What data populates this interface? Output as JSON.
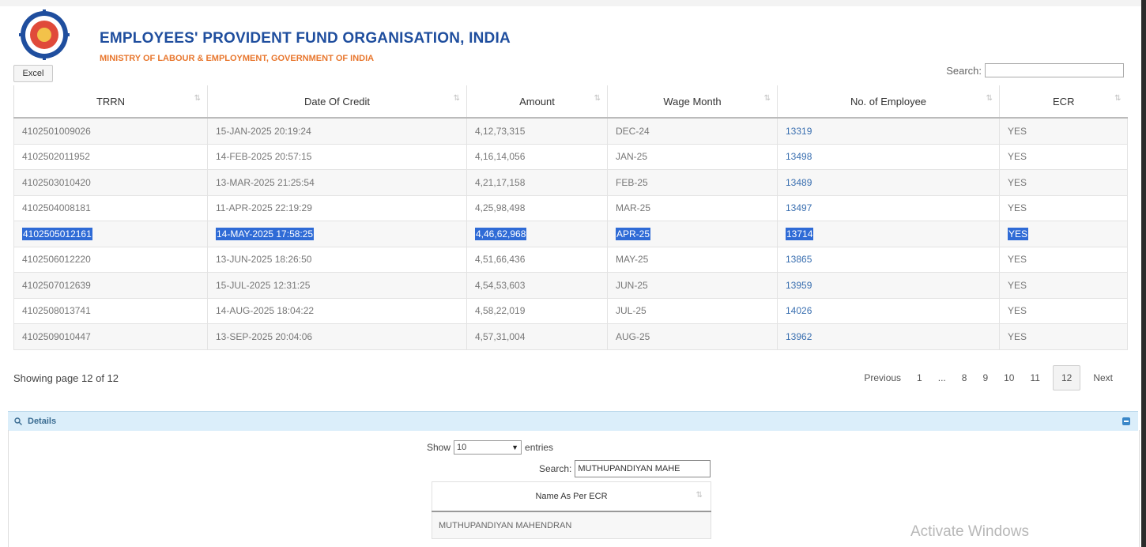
{
  "header": {
    "org_title": "EMPLOYEES' PROVIDENT FUND ORGANISATION, INDIA",
    "org_subtitle": "MINISTRY OF LABOUR & EMPLOYMENT, GOVERNMENT OF INDIA",
    "logo_icon": "epfo-logo-icon"
  },
  "toolbar": {
    "excel_label": "Excel",
    "search_label": "Search:",
    "search_value": ""
  },
  "table": {
    "columns": [
      "TRRN",
      "Date Of Credit",
      "Amount",
      "Wage Month",
      "No. of Employee",
      "ECR"
    ],
    "sort_glyph": "⇅",
    "rows": [
      [
        "4102501009026",
        "15-JAN-2025 20:19:24",
        "4,12,73,315",
        "DEC-24",
        "13319",
        "YES"
      ],
      [
        "4102502011952",
        "14-FEB-2025 20:57:15",
        "4,16,14,056",
        "JAN-25",
        "13498",
        "YES"
      ],
      [
        "4102503010420",
        "13-MAR-2025 21:25:54",
        "4,21,17,158",
        "FEB-25",
        "13489",
        "YES"
      ],
      [
        "4102504008181",
        "11-APR-2025 22:19:29",
        "4,25,98,498",
        "MAR-25",
        "13497",
        "YES"
      ],
      [
        "4102505012161",
        "14-MAY-2025 17:58:25",
        "4,46,62,968",
        "APR-25",
        "13714",
        "YES"
      ],
      [
        "4102506012220",
        "13-JUN-2025 18:26:50",
        "4,51,66,436",
        "MAY-25",
        "13865",
        "YES"
      ],
      [
        "4102507012639",
        "15-JUL-2025 12:31:25",
        "4,54,53,603",
        "JUN-25",
        "13959",
        "YES"
      ],
      [
        "4102508013741",
        "14-AUG-2025 18:04:22",
        "4,58,22,019",
        "JUL-25",
        "14026",
        "YES"
      ],
      [
        "4102509010447",
        "13-SEP-2025 20:04:06",
        "4,57,31,004",
        "AUG-25",
        "13962",
        "YES"
      ]
    ],
    "selected_row_index": 4
  },
  "pagination": {
    "showing_text": "Showing page 12 of 12",
    "previous_label": "Previous",
    "pages": [
      "1",
      "...",
      "8",
      "9",
      "10",
      "11",
      "12"
    ],
    "current_page": "12",
    "next_label": "Next"
  },
  "details": {
    "title": "Details",
    "show_label": "Show",
    "entries_label": "entries",
    "entries_value": "10",
    "search_label": "Search:",
    "search_value": "MUTHUPANDIYAN MAHE",
    "column_header": "Name As Per ECR",
    "rows": [
      "MUTHUPANDIYAN MAHENDRAN"
    ]
  },
  "watermark": "Activate Windows",
  "colors": {
    "brand_blue": "#1f4e9e",
    "brand_orange": "#e8772e",
    "link_blue": "#3a6fb0",
    "selection_blue": "#2f6bd6",
    "details_bar": "#dbeefa"
  }
}
